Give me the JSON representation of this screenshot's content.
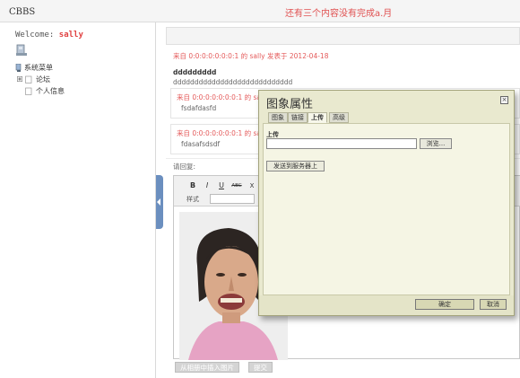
{
  "app": {
    "brand": "CBBS",
    "notice": "还有三个内容没有完成a.月"
  },
  "sidebar": {
    "welcome_prefix": "Welcome:",
    "username": "sally",
    "tree": [
      {
        "label": "系统菜单",
        "icon": "menu-icon"
      },
      {
        "label": "论坛",
        "icon": "folder-icon"
      },
      {
        "label": "个人信息",
        "icon": "page-icon"
      }
    ]
  },
  "thread": {
    "post_meta": "来自 0:0:0:0:0:0:0:1 的 sally 发表于 2012-04-18",
    "post_title": "ddddddddd",
    "post_body": "dddddddddddddddddddddddddddd",
    "replies": [
      {
        "meta": "来自 0:0:0:0:0:0:0:1 的 sa",
        "body": "fsdafdasfd"
      },
      {
        "meta": "来自 0:0:0:0:0:0:0:1 的 sa",
        "body": "fdasafsdsdf"
      }
    ],
    "reply_label": "请回复:"
  },
  "editor": {
    "bold": "B",
    "italic": "I",
    "underline": "U",
    "strike": "ABC",
    "x": "X",
    "style_label": "样式"
  },
  "actions": {
    "insert_from_album": "从相册中插入图片",
    "submit": "提交"
  },
  "dialog": {
    "title": "图象属性",
    "close": "×",
    "tabs": [
      "图象",
      "链接",
      "上传",
      "高级"
    ],
    "active_tab": "上传",
    "upload_label": "上传",
    "browse": "浏览...",
    "send_to_server": "发送到服务器上",
    "ok": "确定",
    "cancel": "取消"
  }
}
